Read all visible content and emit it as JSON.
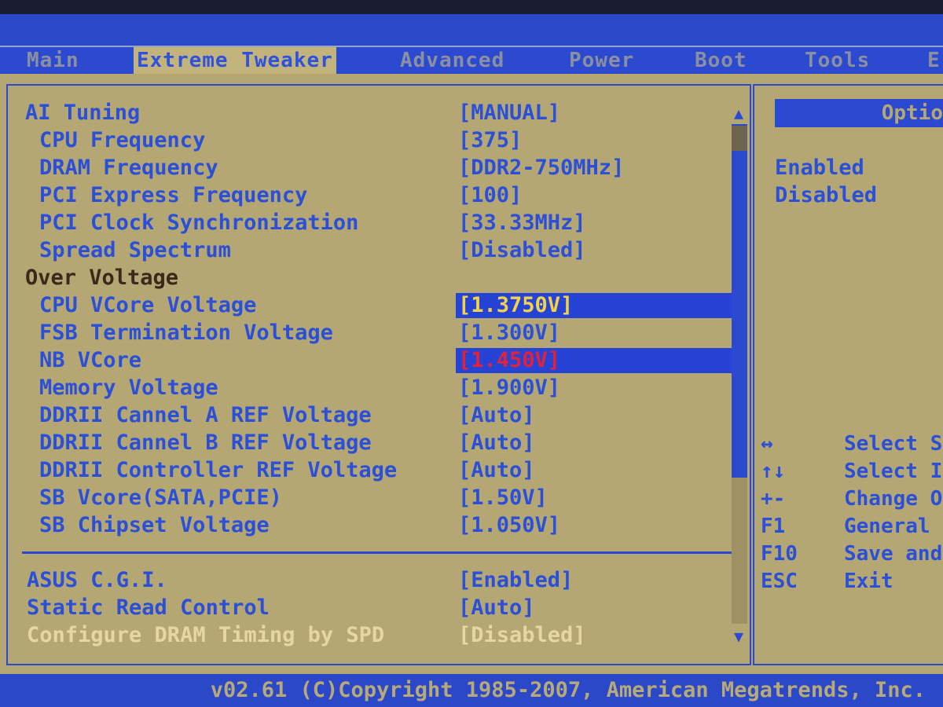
{
  "menu": {
    "tabs": [
      {
        "label": "Main"
      },
      {
        "label": "Extreme Tweaker"
      },
      {
        "label": "Advanced"
      },
      {
        "label": "Power"
      },
      {
        "label": "Boot"
      },
      {
        "label": "Tools"
      },
      {
        "label": "E"
      }
    ],
    "active_tab": "Extreme Tweaker"
  },
  "settings": {
    "items": [
      {
        "label": "AI Tuning",
        "value": "[MANUAL]"
      },
      {
        "label": "CPU Frequency",
        "value": "[375]"
      },
      {
        "label": "DRAM Frequency",
        "value": "[DDR2-750MHz]"
      },
      {
        "label": "PCI Express Frequency",
        "value": "[100]"
      },
      {
        "label": "PCI Clock Synchronization",
        "value": "[33.33MHz]"
      },
      {
        "label": "Spread Spectrum",
        "value": "[Disabled]"
      },
      {
        "label": "Over Voltage",
        "value": ""
      },
      {
        "label": "CPU VCore Voltage",
        "value": "[1.3750V]"
      },
      {
        "label": "FSB Termination Voltage",
        "value": "[1.300V]"
      },
      {
        "label": "NB VCore",
        "value": "[1.450V]"
      },
      {
        "label": "Memory Voltage",
        "value": "[1.900V]"
      },
      {
        "label": "DDRII Cannel A REF Voltage",
        "value": "[Auto]"
      },
      {
        "label": "DDRII Cannel B REF Voltage",
        "value": "[Auto]"
      },
      {
        "label": "DDRII Controller REF Voltage",
        "value": "[Auto]"
      },
      {
        "label": "SB Vcore(SATA,PCIE)",
        "value": "[1.50V]"
      },
      {
        "label": "SB Chipset Voltage",
        "value": "[1.050V]"
      },
      {
        "label": "ASUS C.G.I.",
        "value": "[Enabled]"
      },
      {
        "label": "Static Read Control",
        "value": "[Auto]"
      },
      {
        "label": "Configure DRAM Timing by SPD",
        "value": "[Disabled]"
      }
    ],
    "scroll_up_arrow": "▲",
    "scroll_down_arrow": "▼"
  },
  "options_panel": {
    "header": "Optio",
    "options": [
      "Enabled",
      "Disabled"
    ]
  },
  "help": [
    {
      "key": "↔",
      "desc": "Select S"
    },
    {
      "key": "↑↓",
      "desc": "Select I"
    },
    {
      "key": "+-",
      "desc": "Change O"
    },
    {
      "key": "F1",
      "desc": "General"
    },
    {
      "key": "F10",
      "desc": "Save and"
    },
    {
      "key": "ESC",
      "desc": "Exit"
    }
  ],
  "footer": {
    "text": "v02.61 (C)Copyright 1985-2007, American Megatrends, Inc."
  },
  "colors": {
    "background": "#b4a774",
    "accent_blue": "#2c4ad0",
    "highlight_value": "#f2d24a",
    "warning_value": "#e0233a"
  }
}
